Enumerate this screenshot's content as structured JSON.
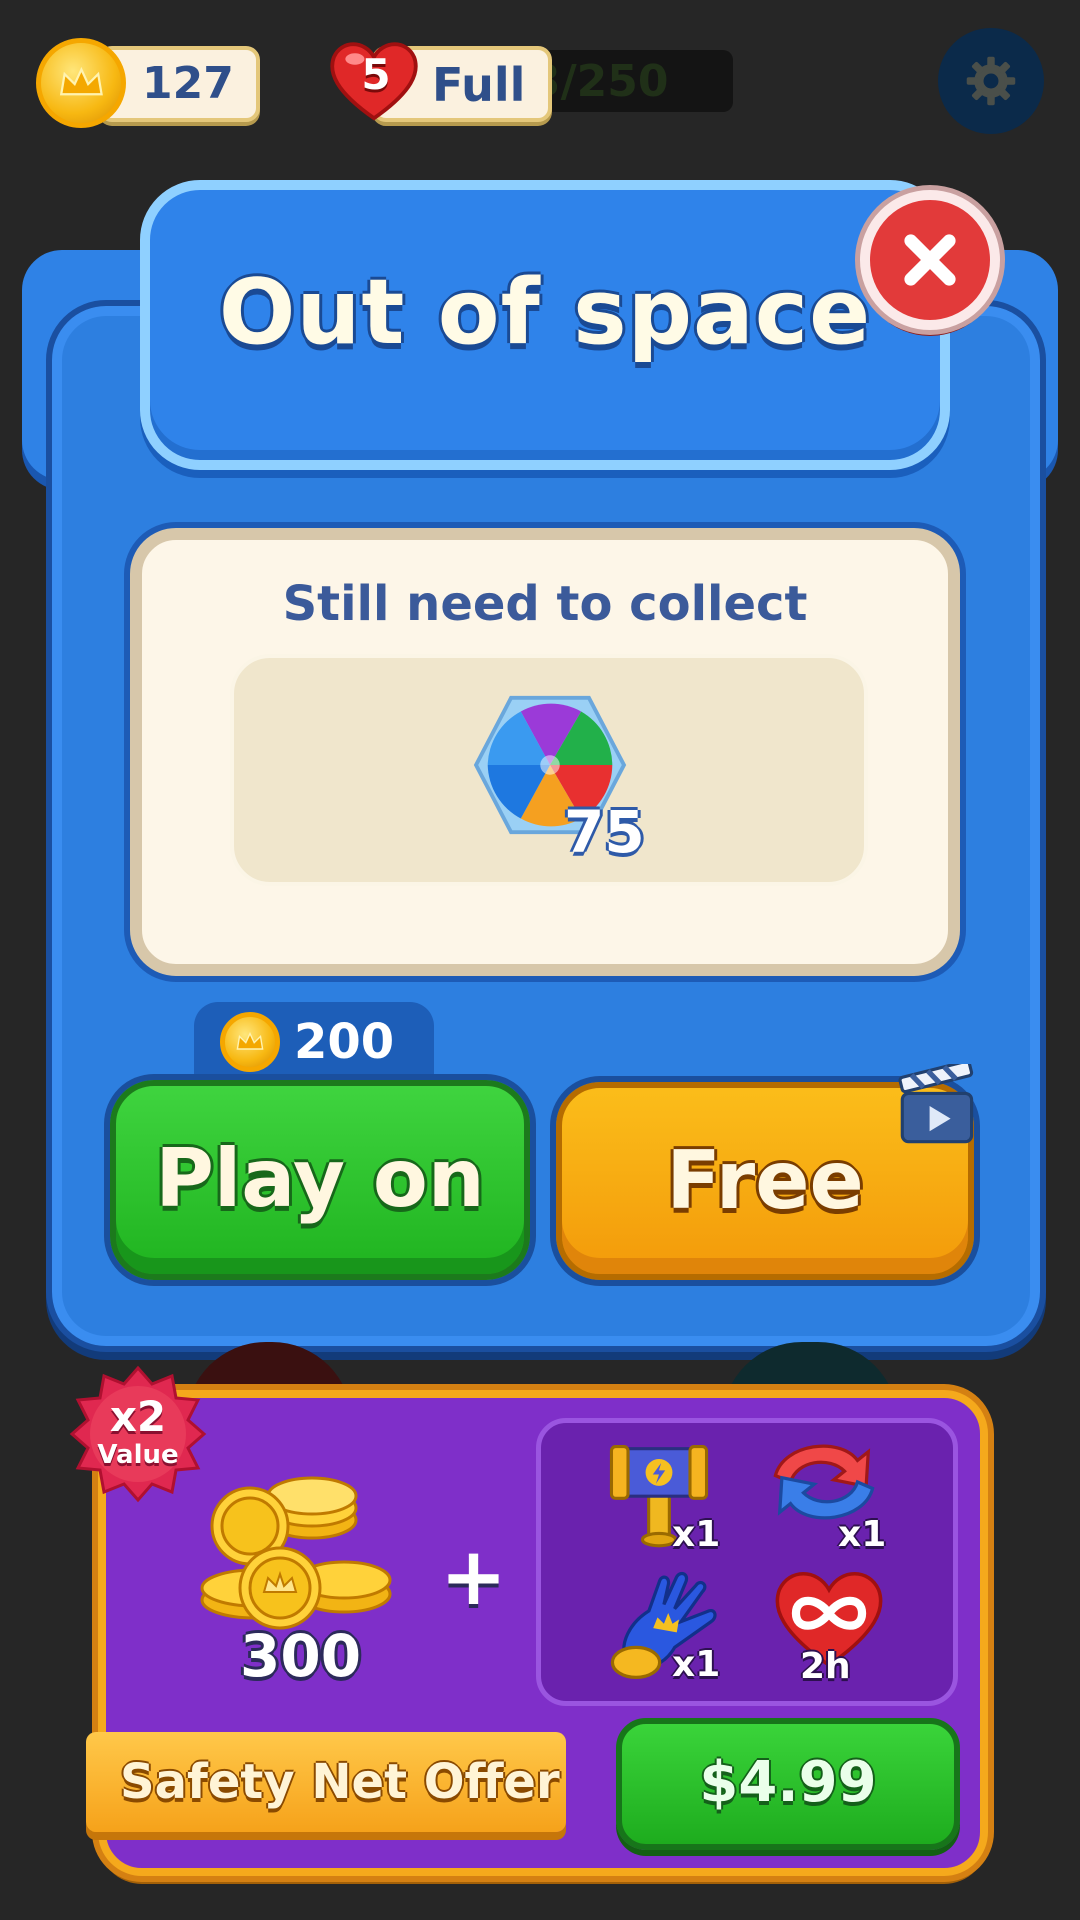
{
  "topbar": {
    "coins": "127",
    "lives_count": "5",
    "lives_status": "Full",
    "progress_text": "3/250"
  },
  "dialog": {
    "title": "Out of space",
    "subtitle": "Still need to collect",
    "goal": {
      "icon": "rainbow-hexagon-candy",
      "count": "75"
    },
    "play_on": {
      "label": "Play on",
      "cost": "200"
    },
    "free": {
      "label": "Free",
      "icon": "video-clapper"
    }
  },
  "offer": {
    "badge_multiplier": "x2",
    "badge_label": "Value",
    "coins_amount": "300",
    "plus": "+",
    "items": [
      {
        "name": "hammer",
        "qty": "x1"
      },
      {
        "name": "shuffle",
        "qty": "x1"
      },
      {
        "name": "glove",
        "qty": "x1"
      },
      {
        "name": "infinite-lives",
        "qty": "2h"
      }
    ],
    "ribbon_label": "Safety Net Offer",
    "price": "$4.99"
  }
}
